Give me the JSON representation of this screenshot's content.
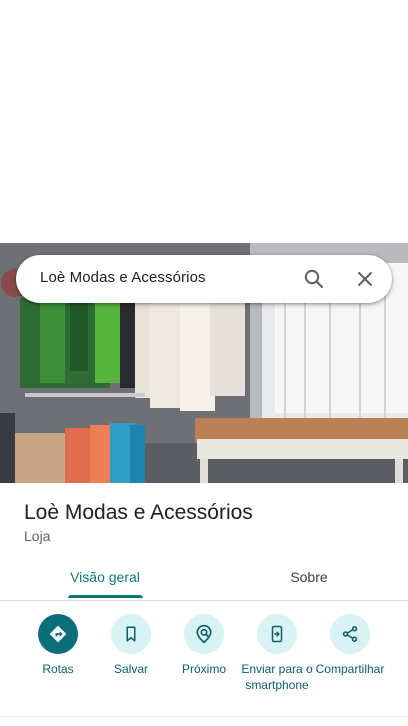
{
  "search": {
    "query": "Loè Modas e Acessórios"
  },
  "place": {
    "name": "Loè Modas e Acessórios",
    "category": "Loja"
  },
  "tabs": [
    {
      "label": "Visão geral",
      "selected": true
    },
    {
      "label": "Sobre",
      "selected": false
    }
  ],
  "actions": [
    {
      "label": "Rotas",
      "icon": "directions-icon"
    },
    {
      "label": "Salvar",
      "icon": "bookmark-icon"
    },
    {
      "label": "Próximo",
      "icon": "nearby-icon"
    },
    {
      "label": "Enviar para o smartphone",
      "icon": "send-to-phone-icon"
    },
    {
      "label": "Compartilhar",
      "icon": "share-icon"
    }
  ],
  "colors": {
    "accent": "#0b7a74",
    "action_bg": "#d9f2f3",
    "primary_action": "#0b6f79"
  }
}
